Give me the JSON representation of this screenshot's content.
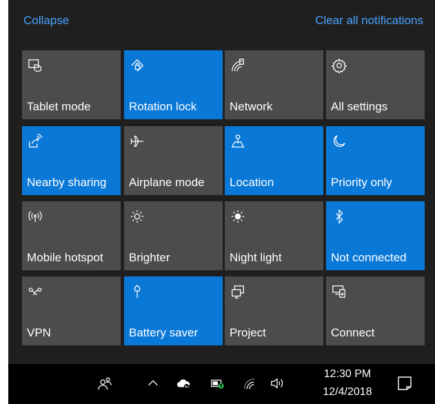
{
  "header": {
    "collapse_label": "Collapse",
    "clear_all_label": "Clear all notifications"
  },
  "colors": {
    "panel_bg": "#1f1f1f",
    "tile_off": "#4c4c4c",
    "tile_on": "#0a78d7",
    "link": "#4aa3ff",
    "taskbar_bg": "#000000"
  },
  "quick_actions": [
    {
      "label": "Tablet mode",
      "icon": "tablet-mode-icon",
      "active": false
    },
    {
      "label": "Rotation lock",
      "icon": "rotation-lock-icon",
      "active": true
    },
    {
      "label": "Network",
      "icon": "network-icon",
      "active": false
    },
    {
      "label": "All settings",
      "icon": "gear-icon",
      "active": false
    },
    {
      "label": "Nearby sharing",
      "icon": "nearby-sharing-icon",
      "active": true
    },
    {
      "label": "Airplane mode",
      "icon": "airplane-icon",
      "active": false
    },
    {
      "label": "Location",
      "icon": "location-icon",
      "active": true
    },
    {
      "label": "Priority only",
      "icon": "moon-icon",
      "active": true
    },
    {
      "label": "Mobile hotspot",
      "icon": "hotspot-icon",
      "active": false
    },
    {
      "label": "Brighter",
      "icon": "sun-icon",
      "active": false
    },
    {
      "label": "Night light",
      "icon": "night-light-icon",
      "active": false
    },
    {
      "label": "Not connected",
      "icon": "bluetooth-icon",
      "active": true
    },
    {
      "label": "VPN",
      "icon": "vpn-icon",
      "active": false
    },
    {
      "label": "Battery saver",
      "icon": "battery-saver-icon",
      "active": true
    },
    {
      "label": "Project",
      "icon": "project-icon",
      "active": false
    },
    {
      "label": "Connect",
      "icon": "connect-icon",
      "active": false
    }
  ],
  "taskbar": {
    "tray_icons": [
      "people-icon",
      "chevron-up-icon",
      "onedrive-icon",
      "battery-icon",
      "wifi-icon",
      "volume-icon"
    ],
    "time": "12:30 PM",
    "date": "12/4/2018",
    "notification_icon": "action-center-icon"
  }
}
